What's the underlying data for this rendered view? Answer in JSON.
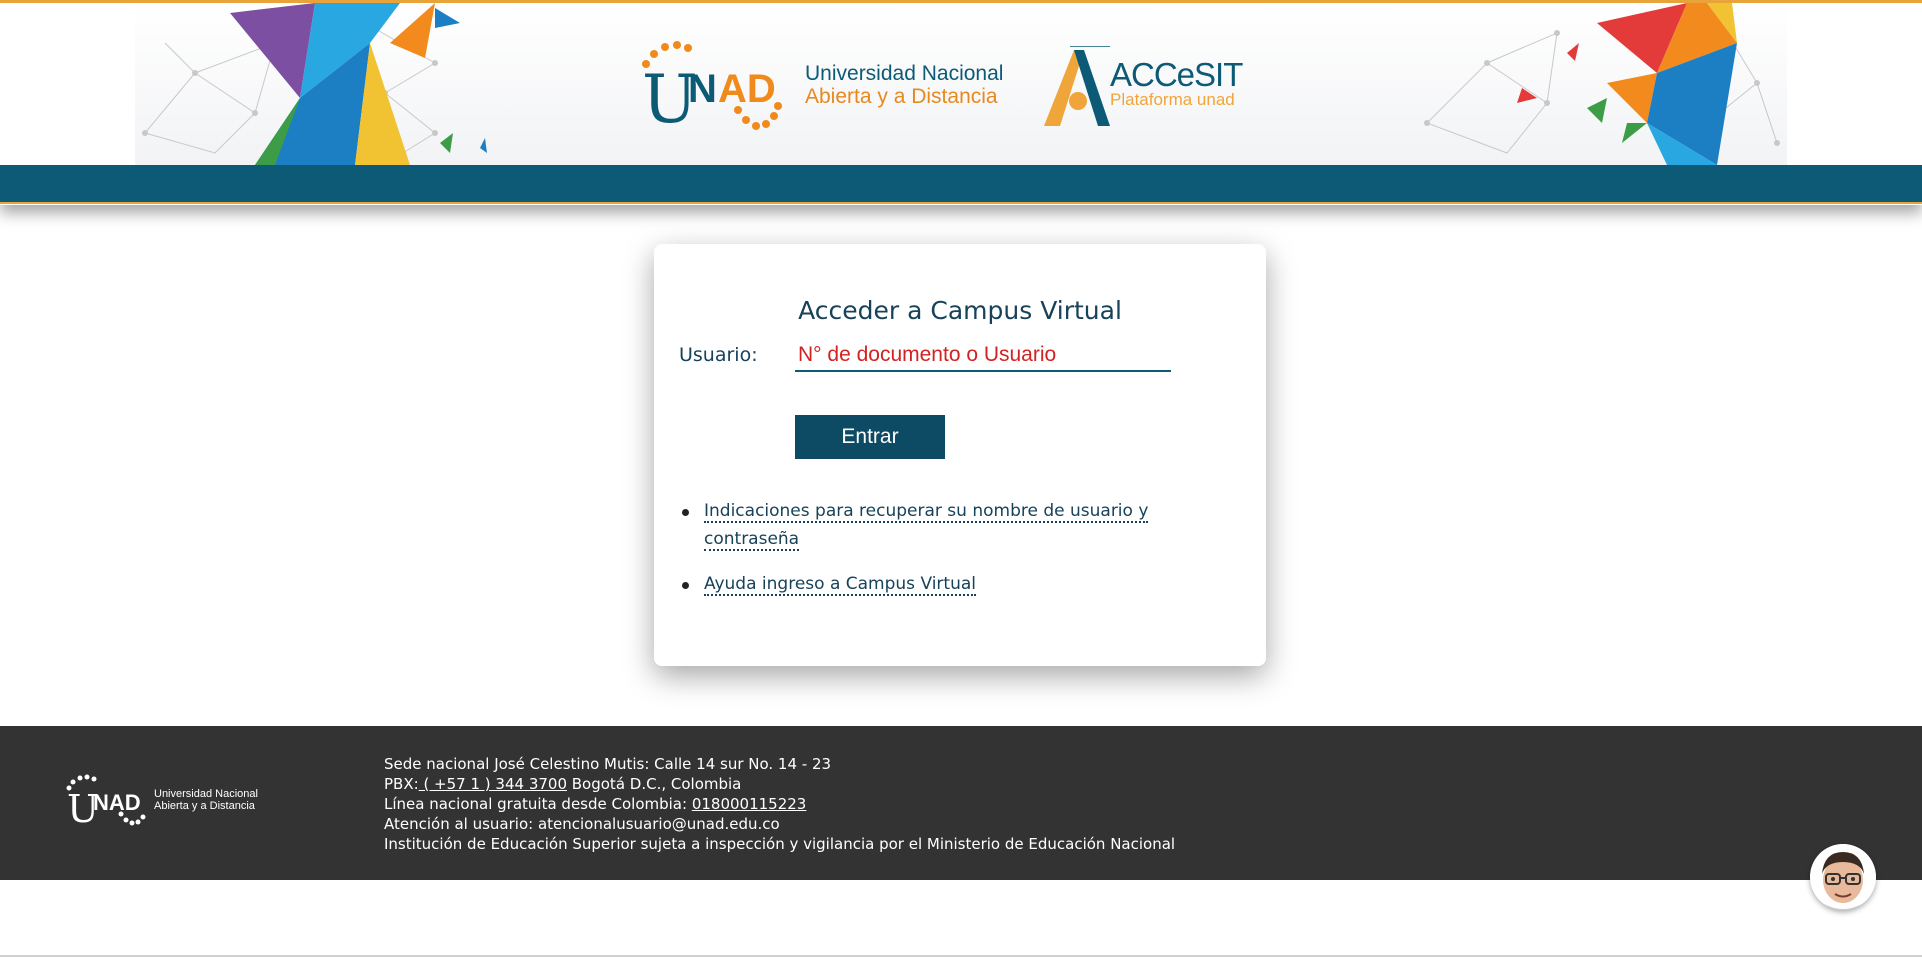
{
  "header": {
    "logo_unad_text": "UNAD",
    "university_name_line1": "Universidad Nacional",
    "university_name_line2": "Abierta y a Distancia",
    "accesit_title": "ACCeSIT",
    "accesit_subtitle": "Plataforma unad",
    "accent_color": "#e8a33a",
    "brand_color": "#0d5a76"
  },
  "login": {
    "title": "Acceder a Campus Virtual",
    "user_label": "Usuario:",
    "user_placeholder": "N° de documento o Usuario",
    "user_value": "",
    "submit_label": "Entrar",
    "links": [
      {
        "label": "Indicaciones para recuperar su nombre de usuario y contraseña"
      },
      {
        "label": "Ayuda ingreso a Campus Virtual"
      }
    ]
  },
  "footer": {
    "logo_text_line1": "Universidad Nacional",
    "logo_text_line2": "Abierta y a Distancia",
    "address": "Sede nacional José Celestino Mutis: Calle 14 sur No. 14 - 23",
    "pbx_prefix": "PBX:",
    "pbx_number": " ( +57 1 ) 344 3700",
    "pbx_suffix": " Bogotá D.C., Colombia",
    "hotline_prefix": "Línea nacional gratuita desde Colombia: ",
    "hotline_number": "018000115223",
    "support": "Atención al usuario: atencionalusuario@unad.edu.co",
    "supervision": "Institución de Educación Superior sujeta a inspección y vigilancia por el Ministerio de Educación Nacional"
  },
  "assistant": {
    "icon": "assistant-avatar-icon"
  }
}
